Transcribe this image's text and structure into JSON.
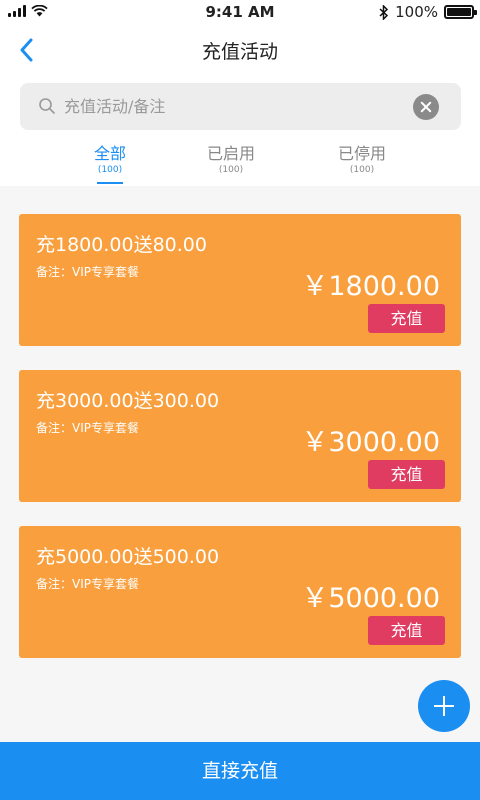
{
  "status_bar": {
    "time": "9:41 AM",
    "battery": "100%",
    "icons": [
      "signal-icon",
      "wifi-icon",
      "bluetooth-icon",
      "battery-icon"
    ]
  },
  "nav": {
    "title": "充值活动",
    "back_icon": "chevron-left-icon"
  },
  "search": {
    "placeholder": "充值活动/备注",
    "value": "",
    "icons": [
      "search-icon",
      "clear-icon"
    ]
  },
  "tabs": [
    {
      "label": "全部",
      "count": "(100)",
      "active": true
    },
    {
      "label": "已启用",
      "count": "(100)",
      "active": false
    },
    {
      "label": "已停用",
      "count": "(100)",
      "active": false
    }
  ],
  "cards": [
    {
      "title": "充1800.00送80.00",
      "note": "备注：VIP专享套餐",
      "amount": "￥1800.00",
      "button": "充值"
    },
    {
      "title": "充3000.00送300.00",
      "note": "备注：VIP专享套餐",
      "amount": "￥3000.00",
      "button": "充值"
    },
    {
      "title": "充5000.00送500.00",
      "note": "备注：VIP专享套餐",
      "amount": "￥5000.00",
      "button": "充值"
    }
  ],
  "fab": {
    "icon": "plus-icon"
  },
  "bottom_button": {
    "label": "直接充值"
  },
  "colors": {
    "accent": "#1b8ef2",
    "card": "#f99f3d",
    "card_button": "#e03c62"
  }
}
